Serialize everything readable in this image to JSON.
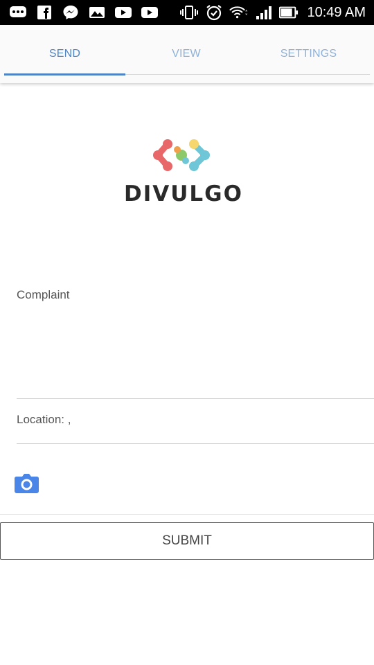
{
  "status_bar": {
    "time": "10:49 AM",
    "icons": [
      "messaging-icon",
      "facebook-icon",
      "messenger-icon",
      "gallery-icon",
      "youtube-icon",
      "youtube-icon",
      "vibrate-icon",
      "alarm-icon",
      "wifi-icon",
      "signal-icon",
      "battery-icon"
    ]
  },
  "tabs": [
    {
      "label": "SEND"
    },
    {
      "label": "VIEW"
    },
    {
      "label": "SETTINGS"
    }
  ],
  "active_tab": "SEND",
  "logo": {
    "text": "DIVULGO",
    "colors": [
      "#e8686a",
      "#f0a04b",
      "#8cc96b",
      "#6fc6d6",
      "#f5d76e"
    ]
  },
  "form": {
    "complaint_label": "Complaint",
    "location_text": "Location: ,",
    "camera_icon": "camera-icon",
    "submit_label": "SUBMIT"
  },
  "colors": {
    "accent": "#4f84c4",
    "accent_light": "#8fb1d8",
    "camera": "#4a86e8"
  }
}
